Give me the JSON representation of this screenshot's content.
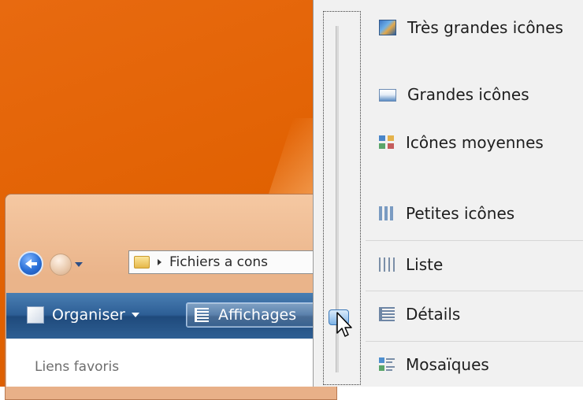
{
  "address_bar": {
    "path_text": "Fichiers a cons"
  },
  "toolbar": {
    "organiser_label": "Organiser",
    "affichages_label": "Affichages"
  },
  "navigation_pane": {
    "favorites_label": "Liens favoris"
  },
  "views_menu": {
    "items": [
      {
        "label": "Très grandes icônes",
        "icon": "extra-large-icons-icon"
      },
      {
        "label": "Grandes icônes",
        "icon": "large-icons-icon"
      },
      {
        "label": "Icônes moyennes",
        "icon": "medium-icons-icon"
      },
      {
        "label": "Petites icônes",
        "icon": "small-icons-icon"
      },
      {
        "label": "Liste",
        "icon": "list-icon"
      },
      {
        "label": "Détails",
        "icon": "details-icon",
        "selected": true
      },
      {
        "label": "Mosaïques",
        "icon": "tiles-icon"
      }
    ]
  },
  "colors": {
    "desktop_orange": "#e06000",
    "toolbar_blue": "#2d5e95",
    "menu_background": "#f1f1f1",
    "slider_thumb": "#a9cdf1"
  }
}
